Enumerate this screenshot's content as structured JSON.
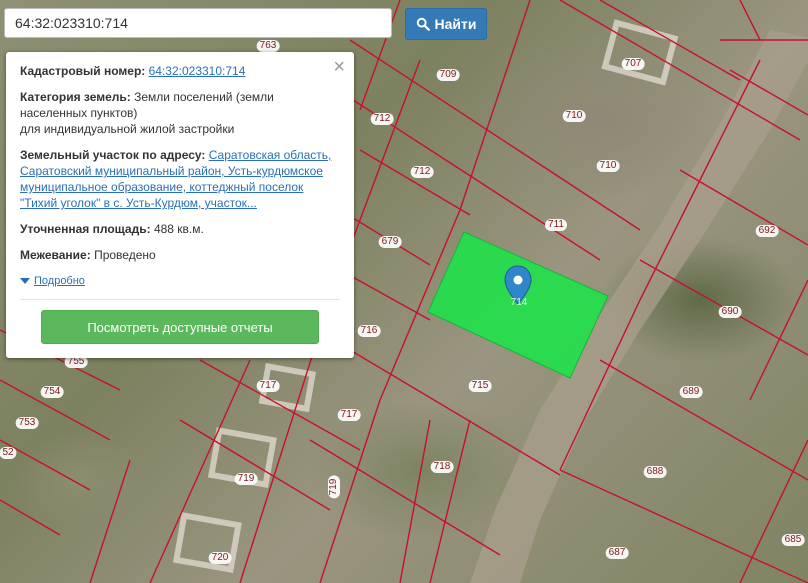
{
  "search": {
    "value": "64:32:023310:714",
    "button_label": "Найти"
  },
  "popup": {
    "cadastral_label": "Кадастровый номер:",
    "cadastral_value": "64:32:023310:714",
    "category_label": "Категория земель:",
    "category_value_1": "Земли поселений (земли населенных пунктов)",
    "category_value_2": "для индивидуальной жилой застройки",
    "address_label": "Земельный участок по адресу:",
    "address_value": "Саратовская область, Саратовский муниципальный район, Усть-курдюмское муниципальное образование, коттеджный поселок \"Тихий уголок\" в с. Усть-Курдюм, участок...",
    "area_label": "Уточненная площадь:",
    "area_value": "488 кв.м.",
    "survey_label": "Межевание:",
    "survey_value": "Проведено",
    "details_label": "Подробно",
    "reports_button": "Посмотреть доступные отчеты"
  },
  "map": {
    "parcel_labels": [
      "763",
      "709",
      "707",
      "712",
      "710",
      "712",
      "710",
      "711",
      "692",
      "679",
      "690",
      "716",
      "714",
      "715",
      "689",
      "717",
      "717",
      "755",
      "754",
      "753",
      "52",
      "718",
      "688",
      "719",
      "719",
      "720",
      "687",
      "685"
    ],
    "highlight_color": "#22e04a",
    "boundary_color": "#c8102e",
    "marker_color": "#2f86c9"
  }
}
